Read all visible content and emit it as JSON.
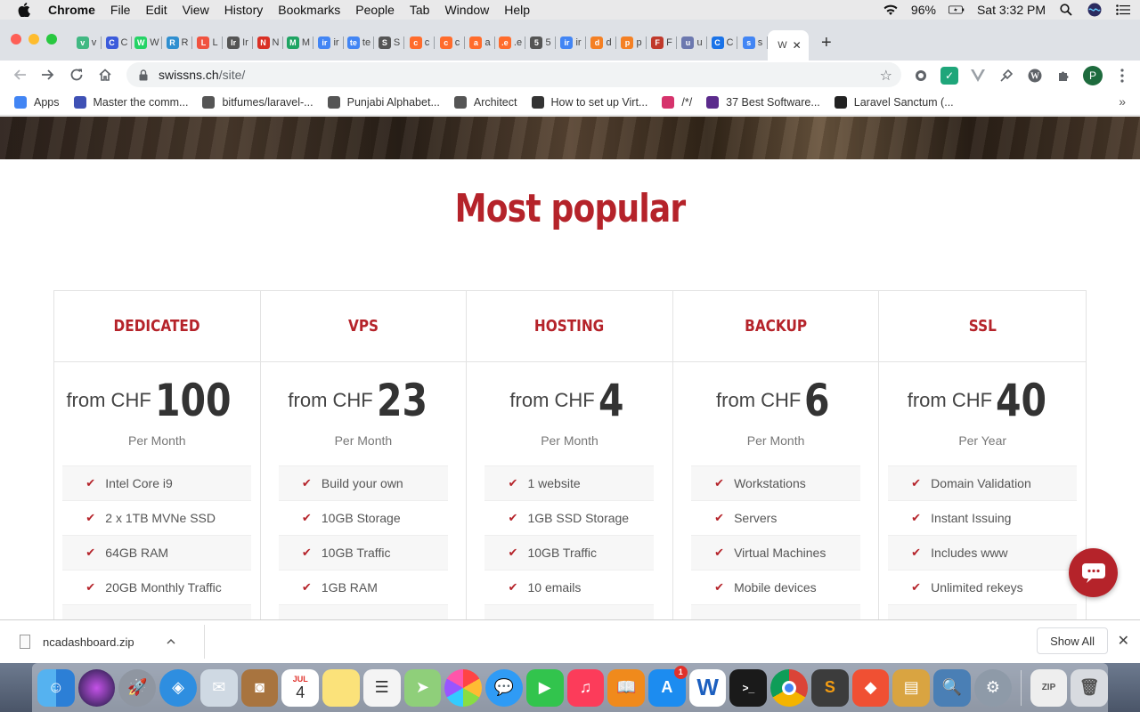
{
  "menubar": {
    "app": "Chrome",
    "items": [
      "File",
      "Edit",
      "View",
      "History",
      "Bookmarks",
      "People",
      "Tab",
      "Window",
      "Help"
    ],
    "battery": "96%",
    "clock": "Sat 3:32 PM"
  },
  "tabs": [
    {
      "letter": "v",
      "color": "#41b883",
      "icon": "vue-icon"
    },
    {
      "letter": "C",
      "color": "#3b5bdb",
      "icon": "diamond-icon"
    },
    {
      "letter": "W",
      "color": "#25d366",
      "icon": "whatsapp-icon"
    },
    {
      "letter": "R",
      "color": "#2f8fd0",
      "icon": "crown-icon"
    },
    {
      "letter": "L",
      "color": "#f05340",
      "icon": "laravel-icon"
    },
    {
      "letter": "Ir",
      "color": "#555555",
      "icon": "globe-icon"
    },
    {
      "letter": "N",
      "color": "#d93025",
      "icon": "gmail-icon"
    },
    {
      "letter": "M",
      "color": "#1fa463",
      "icon": "drive-icon"
    },
    {
      "letter": "ir",
      "color": "#4285f4",
      "icon": "docs-icon"
    },
    {
      "letter": "te",
      "color": "#4285f4",
      "icon": "docs-icon"
    },
    {
      "letter": "S",
      "color": "#555555",
      "icon": "globe-icon"
    },
    {
      "letter": "c",
      "color": "#ff6c2c",
      "icon": "cpanel-icon"
    },
    {
      "letter": "c",
      "color": "#ff6c2c",
      "icon": "cpanel-icon"
    },
    {
      "letter": "a",
      "color": "#ff6c2c",
      "icon": "cpanel-icon"
    },
    {
      "letter": ".e",
      "color": "#ff6c2c",
      "icon": "cpanel-icon"
    },
    {
      "letter": "5",
      "color": "#555555",
      "icon": "globe-icon"
    },
    {
      "letter": "ir",
      "color": "#4285f4",
      "icon": "google-icon"
    },
    {
      "letter": "d",
      "color": "#f48024",
      "icon": "stackoverflow-icon"
    },
    {
      "letter": "p",
      "color": "#f48024",
      "icon": "stackoverflow-icon"
    },
    {
      "letter": "F",
      "color": "#c0392b",
      "icon": "hackernoon-icon"
    },
    {
      "letter": "u",
      "color": "#6c78af",
      "icon": "phpmyadmin-icon"
    },
    {
      "letter": "C",
      "color": "#1a73e8",
      "icon": "font-icon"
    },
    {
      "letter": "s",
      "color": "#4285f4",
      "icon": "google-icon"
    }
  ],
  "active_tab": {
    "label": "W",
    "close": "✕"
  },
  "newtab": "+",
  "omnibox": {
    "domain": "swissns.ch",
    "path": "/site/"
  },
  "profile_letter": "P",
  "bookmarks": [
    {
      "label": "Apps",
      "icon": "apps-grid-icon",
      "color": "#4285f4"
    },
    {
      "label": "Master the comm...",
      "icon": "vue-icon",
      "color": "#3f51b5"
    },
    {
      "label": "bitfumes/laravel-...",
      "icon": "github-icon",
      "color": "#555555"
    },
    {
      "label": "Punjabi Alphabet...",
      "icon": "globe-icon",
      "color": "#555555"
    },
    {
      "label": "Architect",
      "icon": "globe-icon",
      "color": "#555555"
    },
    {
      "label": "How to set up Virt...",
      "icon": "do-icon",
      "color": "#333333"
    },
    {
      "label": "/*/",
      "icon": "m-icon",
      "color": "#d6336c"
    },
    {
      "label": "37 Best Software...",
      "icon": "colorlib-icon",
      "color": "#5b2b8c"
    },
    {
      "label": "Laravel Sanctum (...",
      "icon": "doc-icon",
      "color": "#222222"
    }
  ],
  "page": {
    "title": "Most popular",
    "plans": [
      {
        "name": "DEDICATED",
        "prefix": "from CHF",
        "amount": "100",
        "period": "Per Month",
        "features": [
          "Intel Core i9",
          "2 x 1TB MVNe SSD",
          "64GB RAM",
          "20GB Monthly Traffic"
        ]
      },
      {
        "name": "VPS",
        "prefix": "from CHF",
        "amount": "23",
        "period": "Per Month",
        "features": [
          "Build your own",
          "10GB Storage",
          "10GB Traffic",
          "1GB RAM"
        ]
      },
      {
        "name": "HOSTING",
        "prefix": "from CHF",
        "amount": "4",
        "period": "Per Month",
        "features": [
          "1 website",
          "1GB SSD Storage",
          "10GB Traffic",
          "10 emails"
        ]
      },
      {
        "name": "BACKUP",
        "prefix": "from CHF",
        "amount": "6",
        "period": "Per Month",
        "features": [
          "Workstations",
          "Servers",
          "Virtual Machines",
          "Mobile devices"
        ]
      },
      {
        "name": "SSL",
        "prefix": "from CHF",
        "amount": "40",
        "period": "Per Year",
        "features": [
          "Domain Validation",
          "Instant Issuing",
          "Includes www",
          "Unlimited rekeys"
        ]
      }
    ]
  },
  "downloads": {
    "file": "ncadashboard.zip",
    "show_all": "Show All"
  },
  "dock": {
    "calendar_month": "JUL",
    "calendar_day": "4",
    "appstore_badge": "1"
  },
  "colors": {
    "brand": "#b5232a"
  }
}
